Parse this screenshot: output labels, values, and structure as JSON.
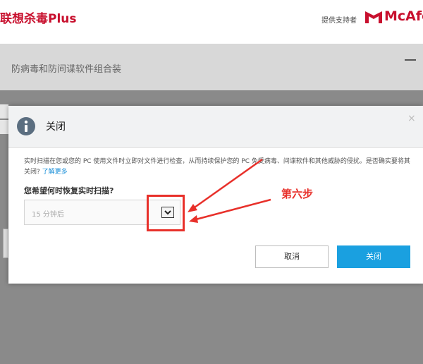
{
  "header": {
    "app_title": "联想杀毒Plus",
    "powered_by": "提供支持者",
    "brand": "McAfe"
  },
  "background_window": {
    "subtitle": "防病毒和防间谍软件组合装"
  },
  "dialog": {
    "title": "关闭",
    "close_glyph": "×",
    "body_text": "实时扫描在您或您的 PC 使用文件时立即对文件进行检查，从而持续保护您的 PC 免受病毒、间谍软件和其他威胁的侵扰。是否确实要将其关闭? ",
    "learn_more": "了解更多",
    "question": "您希望何时恢复实时扫描?",
    "select_value": "15 分钟后",
    "cancel_label": "取消",
    "confirm_label": "关闭"
  },
  "annotation": {
    "step_label": "第六步"
  },
  "colors": {
    "brand_red": "#c8102e",
    "primary_blue": "#1aa0e0",
    "annotation_red": "#e8302a"
  },
  "icons": {
    "info": "info-icon",
    "dropdown": "chevron-down-icon",
    "brand": "mcafee-shield-icon"
  }
}
